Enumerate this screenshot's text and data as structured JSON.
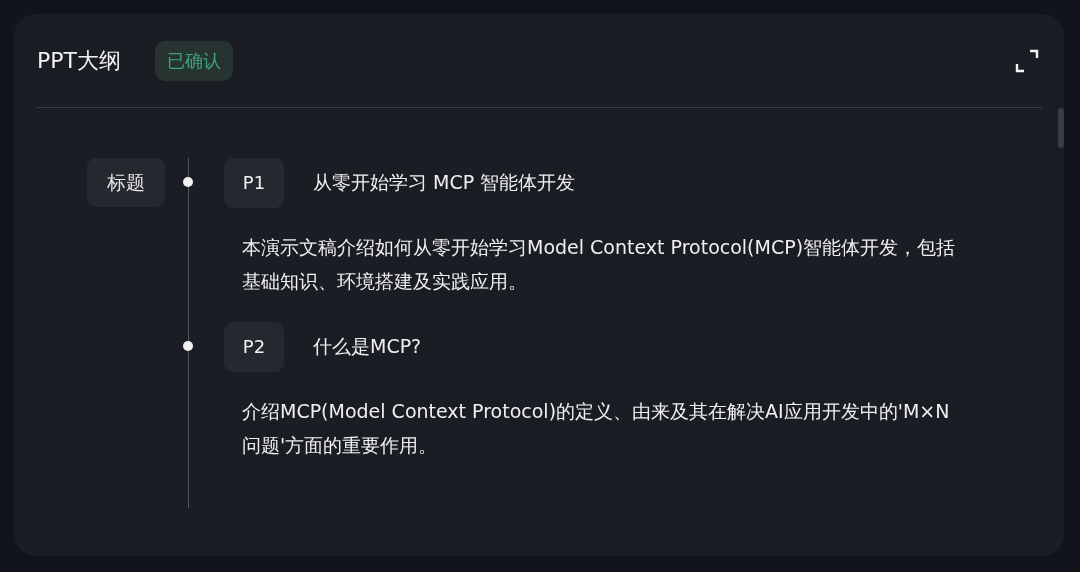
{
  "panel": {
    "title": "PPT大纲",
    "status": "已确认"
  },
  "outline": {
    "label": "标题",
    "pages": [
      {
        "page": "P1",
        "title": "从零开始学习 MCP 智能体开发",
        "description": "本演示文稿介绍如何从零开始学习Model Context Protocol(MCP)智能体开发，包括基础知识、环境搭建及实践应用。"
      },
      {
        "page": "P2",
        "title": "什么是MCP?",
        "description": "介绍MCP(Model Context Protocol)的定义、由来及其在解决AI应用开发中的'M×N问题'方面的重要作用。"
      }
    ]
  }
}
